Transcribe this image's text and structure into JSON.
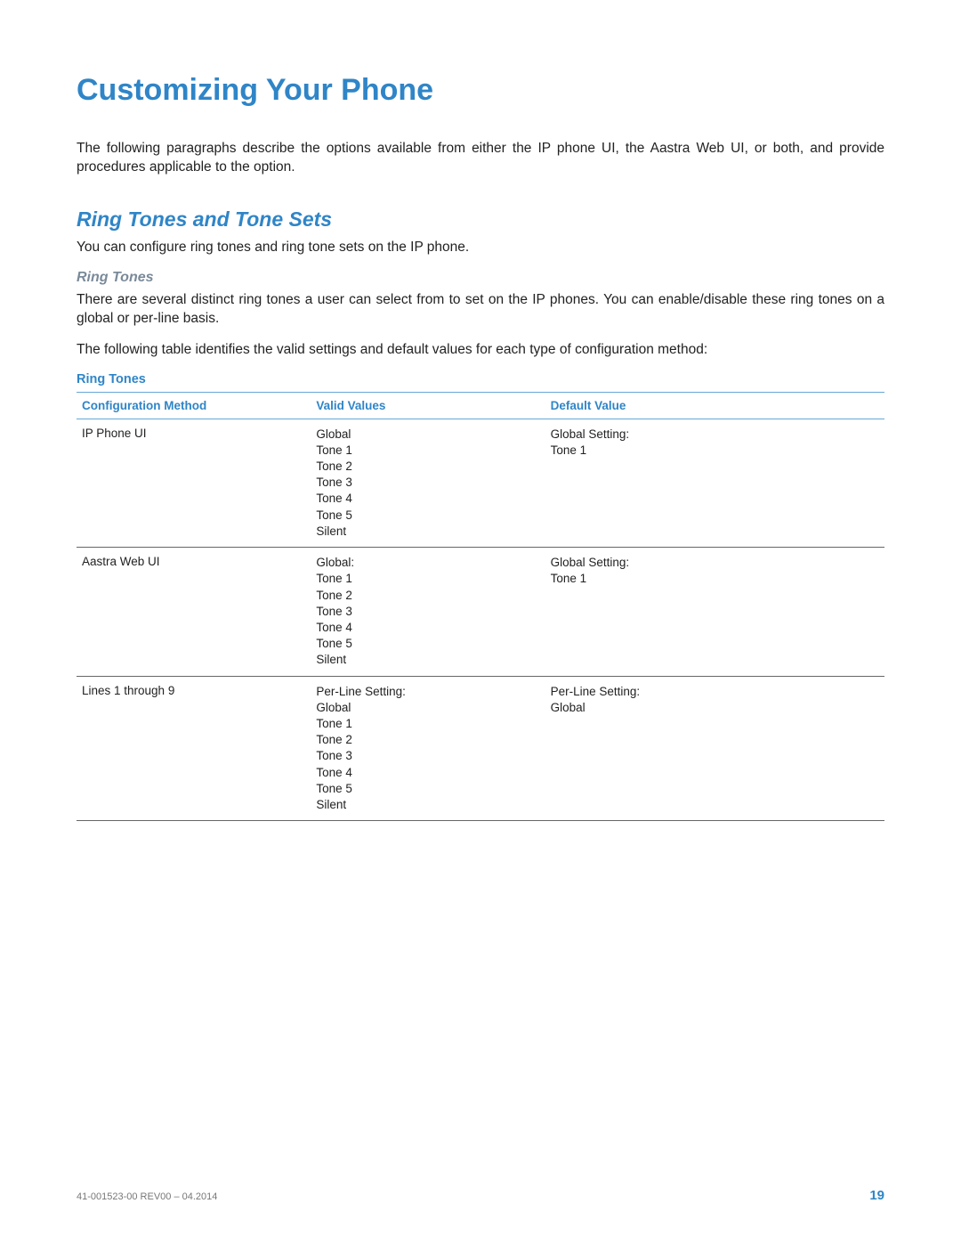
{
  "chapter_title": "Customizing Your Phone",
  "intro": "The following paragraphs describe the options available from either the IP phone UI, the Aastra Web UI, or both, and provide procedures applicable to the option.",
  "section": {
    "heading": "Ring Tones and Tone Sets",
    "text": "You can configure ring tones and ring tone sets on the IP phone.",
    "sub_heading": "Ring Tones",
    "sub_text1": "There are several distinct ring tones a user can select from to set on the IP phones. You can enable/disable these ring tones on a global or per-line basis.",
    "sub_text2": "The following table identifies the valid settings and default values for each type of configuration method:"
  },
  "table": {
    "title": "Ring Tones",
    "headers": {
      "method": "Configuration Method",
      "valid": "Valid Values",
      "default": "Default Value"
    },
    "rows": [
      {
        "method": "IP Phone UI",
        "valid": [
          "Global",
          "Tone 1",
          "Tone 2",
          "Tone 3",
          "Tone 4",
          "Tone 5",
          "Silent"
        ],
        "default": [
          "Global Setting:",
          "Tone 1"
        ]
      },
      {
        "method": "Aastra Web UI",
        "valid": [
          "Global:",
          "Tone 1",
          "Tone 2",
          "Tone 3",
          "Tone 4",
          "Tone 5",
          "Silent"
        ],
        "default": [
          "Global Setting:",
          "Tone 1"
        ]
      },
      {
        "method": "Lines 1 through 9",
        "valid": [
          "Per-Line Setting:",
          "Global",
          "Tone 1",
          "Tone 2",
          "Tone 3",
          "Tone 4",
          "Tone 5",
          "Silent"
        ],
        "default": [
          "Per-Line Setting:",
          "Global"
        ]
      }
    ]
  },
  "footer": {
    "doc_id": "41-001523-00 REV00 – 04.2014",
    "page": "19"
  }
}
